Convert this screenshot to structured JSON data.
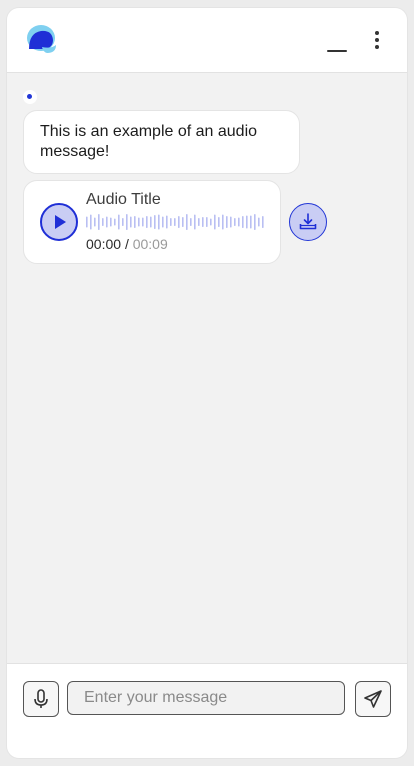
{
  "colors": {
    "accent": "#2236d6",
    "accent_light": "#c9cdf4",
    "logo_light": "#7fd0f0",
    "background": "#f2f2f2"
  },
  "header": {
    "logo_icon": "chat-bubble-logo-icon",
    "minimize_icon": "minimize-icon",
    "more_icon": "more-vertical-icon"
  },
  "messages": [
    {
      "sender": "bot",
      "type": "text",
      "text": "This is an example of an audio message!"
    },
    {
      "sender": "bot",
      "type": "audio",
      "title": "Audio Title",
      "current_time": "00:00",
      "separator": "/",
      "duration": "00:09",
      "progress": 0
    }
  ],
  "composer": {
    "placeholder": "Enter your message",
    "mic_icon": "microphone-icon",
    "send_icon": "send-icon"
  }
}
